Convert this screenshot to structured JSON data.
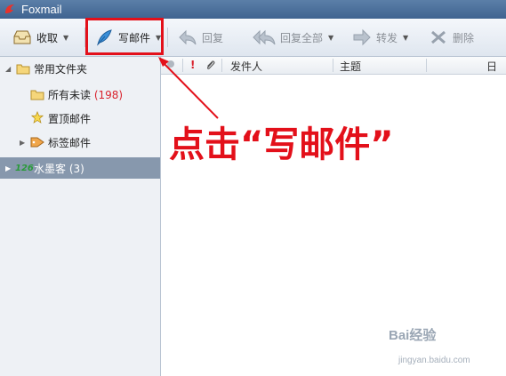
{
  "window": {
    "title": "Foxmail"
  },
  "toolbar": {
    "receive_label": "收取",
    "compose_label": "写邮件",
    "reply_label": "回复",
    "reply_all_label": "回复全部",
    "forward_label": "转发",
    "delete_label": "删除"
  },
  "sidebar": {
    "folders_label": "常用文件夹",
    "unread_label": "所有未读",
    "unread_count": "(198)",
    "pinned_label": "置顶邮件",
    "tagged_label": "标签邮件",
    "account_label": "水墨客",
    "account_count": "(3)",
    "account_badge": "126"
  },
  "mail_list": {
    "columns": {
      "sender": "发件人",
      "subject": "主题",
      "date": "日期"
    },
    "flag_symbol": "!"
  },
  "annotation": {
    "callout_text": "点击“写邮件”"
  },
  "watermark": {
    "brand": "Bai经验",
    "url": "jingyan.baidu.com"
  },
  "colors": {
    "highlight": "#e3101a",
    "titlebar": "#4a6f9a",
    "account_bg": "#8798ad",
    "unread_count": "#d9232e"
  }
}
